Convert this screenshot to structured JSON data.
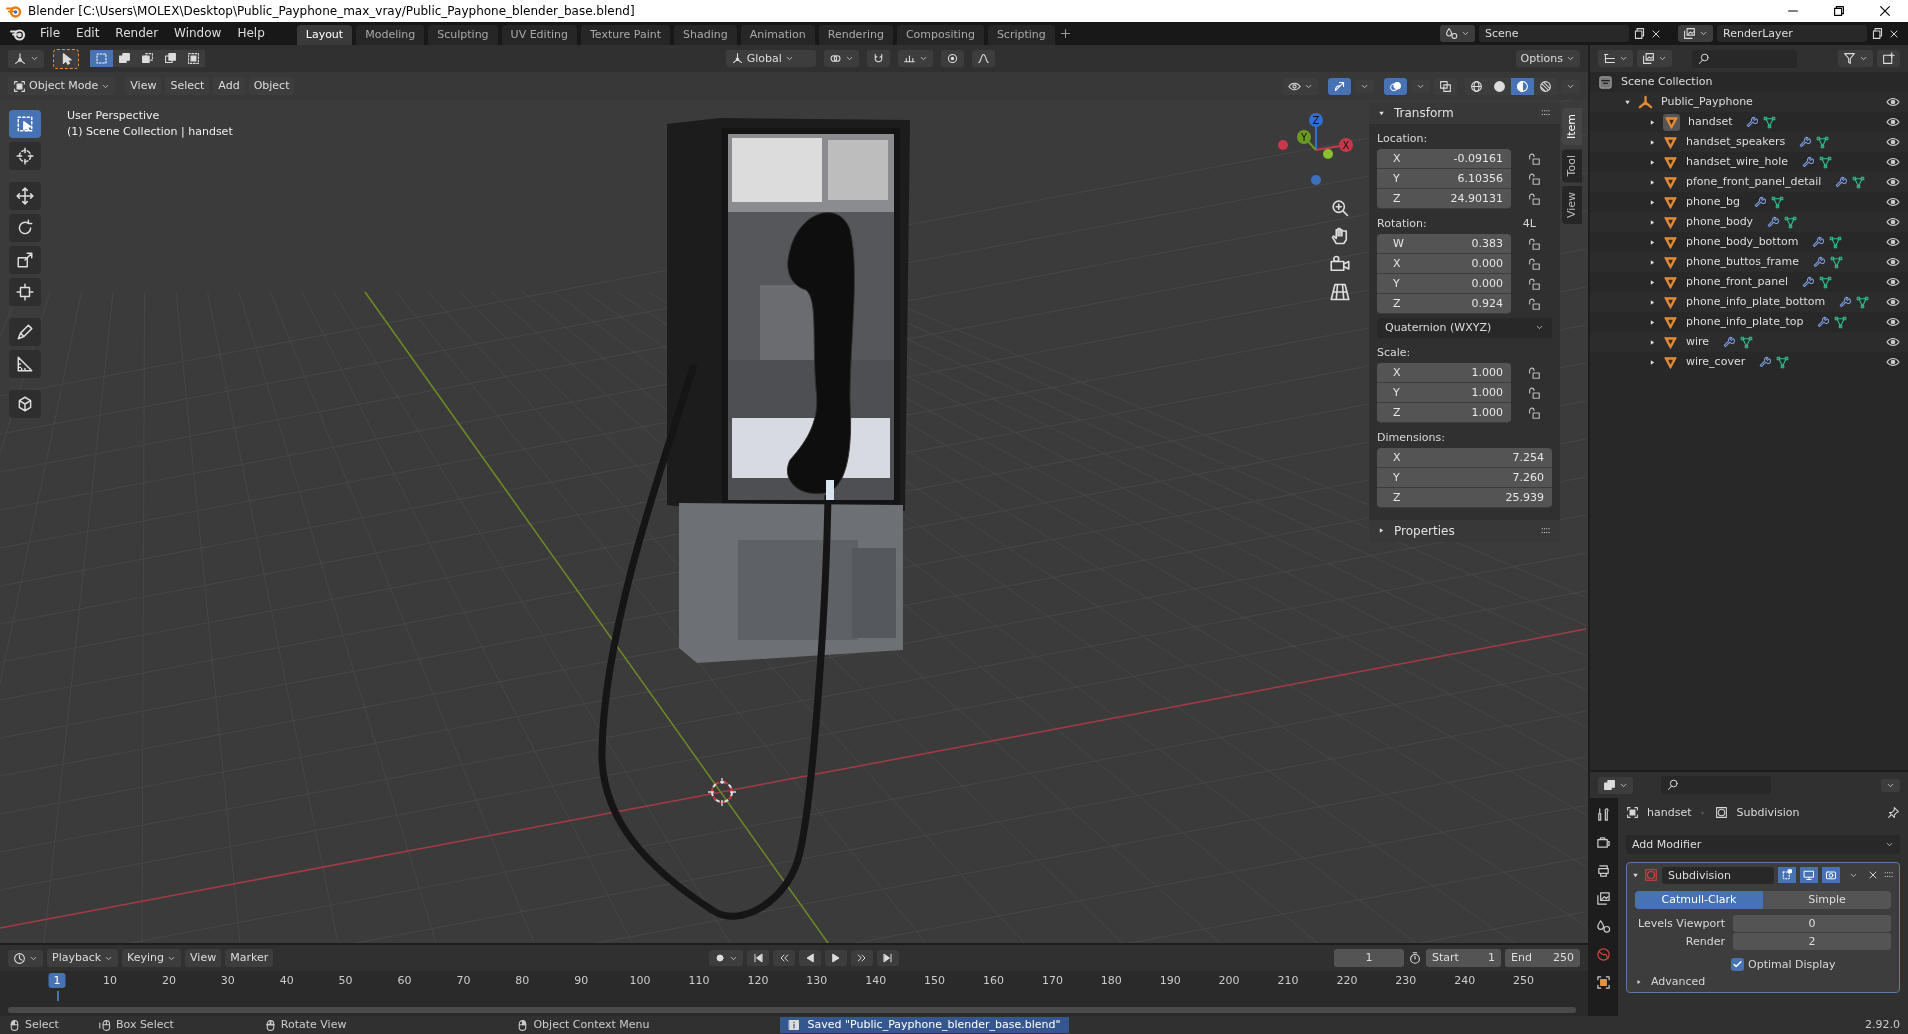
{
  "window": {
    "title": "Blender [C:\\Users\\MOLEX\\Desktop\\Public_Payphone_max_vray/Public_Payphone_blender_base.blend]"
  },
  "menu": [
    "File",
    "Edit",
    "Render",
    "Window",
    "Help"
  ],
  "workspaces": [
    {
      "label": "Layout",
      "selected": true
    },
    {
      "label": "Modeling",
      "selected": false
    },
    {
      "label": "Sculpting",
      "selected": false
    },
    {
      "label": "UV Editing",
      "selected": false
    },
    {
      "label": "Texture Paint",
      "selected": false
    },
    {
      "label": "Shading",
      "selected": false
    },
    {
      "label": "Animation",
      "selected": false
    },
    {
      "label": "Rendering",
      "selected": false
    },
    {
      "label": "Compositing",
      "selected": false
    },
    {
      "label": "Scripting",
      "selected": false
    }
  ],
  "scene": "Scene",
  "view_layer": "RenderLayer",
  "tool_settings": {
    "orientation": "Global",
    "options": "Options",
    "select_modes": [
      {
        "selected": true
      },
      {
        "selected": false
      },
      {
        "selected": false
      },
      {
        "selected": false
      },
      {
        "selected": false
      }
    ]
  },
  "viewport_header": {
    "mode": "Object Mode",
    "menus": [
      "View",
      "Select",
      "Add",
      "Object"
    ],
    "gizmos_on": true,
    "overlays_on": true,
    "shading": [
      {
        "kind": "wireframe",
        "selected": false
      },
      {
        "kind": "solid",
        "selected": false
      },
      {
        "kind": "material",
        "selected": true
      },
      {
        "kind": "rendered",
        "selected": false
      }
    ]
  },
  "viewport": {
    "view_name": "User Perspective",
    "context": "(1) Scene Collection | handset",
    "gizmo_labels": [
      "Z",
      "Y",
      "X"
    ]
  },
  "toolbar": [
    {
      "kind": "select-box",
      "selected": true
    },
    {
      "kind": "cursor",
      "selected": false
    },
    {
      "kind": "move",
      "selected": false
    },
    {
      "kind": "rotate",
      "selected": false
    },
    {
      "kind": "scale",
      "selected": false
    },
    {
      "kind": "transform",
      "selected": false
    },
    {
      "kind": "annotate",
      "selected": false
    },
    {
      "kind": "measure",
      "selected": false
    },
    {
      "kind": "add-cube",
      "selected": false
    }
  ],
  "sidebar": {
    "tabs": [
      {
        "label": "Item",
        "selected": true
      },
      {
        "label": "Tool",
        "selected": false
      },
      {
        "label": "View",
        "selected": false
      }
    ],
    "panels": [
      {
        "title": "Transform",
        "expanded": true
      },
      {
        "title": "Properties",
        "expanded": false
      }
    ],
    "transform": [
      {
        "label": "Location:",
        "lockable": true,
        "fields": [
          {
            "axis": "X",
            "value": "-0.09161"
          },
          {
            "axis": "Y",
            "value": "6.10356"
          },
          {
            "axis": "Z",
            "value": "24.90131"
          }
        ]
      },
      {
        "label": "Rotation:",
        "note": "4L",
        "lockable": true,
        "fields": [
          {
            "axis": "W",
            "value": "0.383"
          },
          {
            "axis": "X",
            "value": "0.000"
          },
          {
            "axis": "Y",
            "value": "0.000"
          },
          {
            "axis": "Z",
            "value": "0.924"
          }
        ],
        "mode": "Quaternion (WXYZ)"
      },
      {
        "label": "Scale:",
        "lockable": true,
        "fields": [
          {
            "axis": "X",
            "value": "1.000"
          },
          {
            "axis": "Y",
            "value": "1.000"
          },
          {
            "axis": "Z",
            "value": "1.000"
          }
        ]
      },
      {
        "label": "Dimensions:",
        "lockable": false,
        "fields": [
          {
            "axis": "X",
            "value": "7.254"
          },
          {
            "axis": "Y",
            "value": "7.260"
          },
          {
            "axis": "Z",
            "value": "25.939"
          }
        ]
      }
    ]
  },
  "outliner": {
    "root": "Scene Collection",
    "children": [
      {
        "name": "Public_Payphone",
        "kind": "empty",
        "expanded": true,
        "active": false,
        "children": [
          {
            "name": "handset",
            "kind": "mesh",
            "active": true,
            "expanded": false
          },
          {
            "name": "handset_speakers",
            "kind": "mesh",
            "active": false,
            "expanded": false
          },
          {
            "name": "handset_wire_hole",
            "kind": "mesh",
            "active": false,
            "expanded": false
          },
          {
            "name": "pfone_front_panel_detail",
            "kind": "mesh",
            "active": false,
            "expanded": false
          },
          {
            "name": "phone_bg",
            "kind": "mesh",
            "active": false,
            "expanded": false
          },
          {
            "name": "phone_body",
            "kind": "mesh",
            "active": false,
            "expanded": false
          },
          {
            "name": "phone_body_bottom",
            "kind": "mesh",
            "active": false,
            "expanded": false
          },
          {
            "name": "phone_buttos_frame",
            "kind": "mesh",
            "active": false,
            "expanded": false
          },
          {
            "name": "phone_front_panel",
            "kind": "mesh",
            "active": false,
            "expanded": false
          },
          {
            "name": "phone_info_plate_bottom",
            "kind": "mesh",
            "active": false,
            "expanded": false
          },
          {
            "name": "phone_info_plate_top",
            "kind": "mesh",
            "active": false,
            "expanded": false
          },
          {
            "name": "wire",
            "kind": "mesh",
            "active": false,
            "expanded": false
          },
          {
            "name": "wire_cover",
            "kind": "mesh",
            "active": false,
            "expanded": false
          }
        ]
      }
    ]
  },
  "properties": {
    "tabs": [
      {
        "kind": "tool"
      },
      {
        "kind": "render"
      },
      {
        "kind": "output"
      },
      {
        "kind": "view-layer"
      },
      {
        "kind": "scene"
      },
      {
        "kind": "world"
      },
      {
        "kind": "object"
      }
    ],
    "object": "handset",
    "modifier_path": "Subdivision",
    "add_modifier": "Add Modifier",
    "modifier": {
      "name": "Subdivision",
      "expanded": true,
      "edit_mode": true,
      "viewport": true,
      "render": true,
      "methods": [
        {
          "label": "Catmull-Clark",
          "selected": true
        },
        {
          "label": "Simple",
          "selected": false
        }
      ],
      "fields": [
        {
          "label": "Levels Viewport",
          "value": "0"
        },
        {
          "label": "Render",
          "value": "2"
        }
      ],
      "optimal_display": {
        "label": "Optimal Display",
        "checked": true
      },
      "advanced": {
        "label": "Advanced",
        "expanded": false
      }
    }
  },
  "timeline": {
    "menus": [
      {
        "label": "Playback",
        "dropdown": true
      },
      {
        "label": "Keying",
        "dropdown": true
      },
      {
        "label": "View",
        "dropdown": false
      },
      {
        "label": "Marker",
        "dropdown": false
      }
    ],
    "current_frame": "1",
    "start_label": "Start",
    "start": "1",
    "end_label": "End",
    "end": "250",
    "playhead": "1",
    "ticks": [
      "10",
      "20",
      "30",
      "40",
      "50",
      "60",
      "70",
      "80",
      "90",
      "100",
      "110",
      "120",
      "130",
      "140",
      "150",
      "160",
      "170",
      "180",
      "190",
      "200",
      "210",
      "220",
      "230",
      "240",
      "250"
    ]
  },
  "status_bar": {
    "hints": [
      {
        "kind": "left-click",
        "label": "Select"
      },
      {
        "kind": "left-drag",
        "label": "Box Select"
      },
      {
        "kind": "middle-drag",
        "label": "Rotate View"
      },
      {
        "kind": "right-click",
        "label": "Object Context Menu"
      }
    ],
    "message": "Saved \"Public_Payphone_blender_base.blend\"",
    "version": "2.92.0"
  }
}
